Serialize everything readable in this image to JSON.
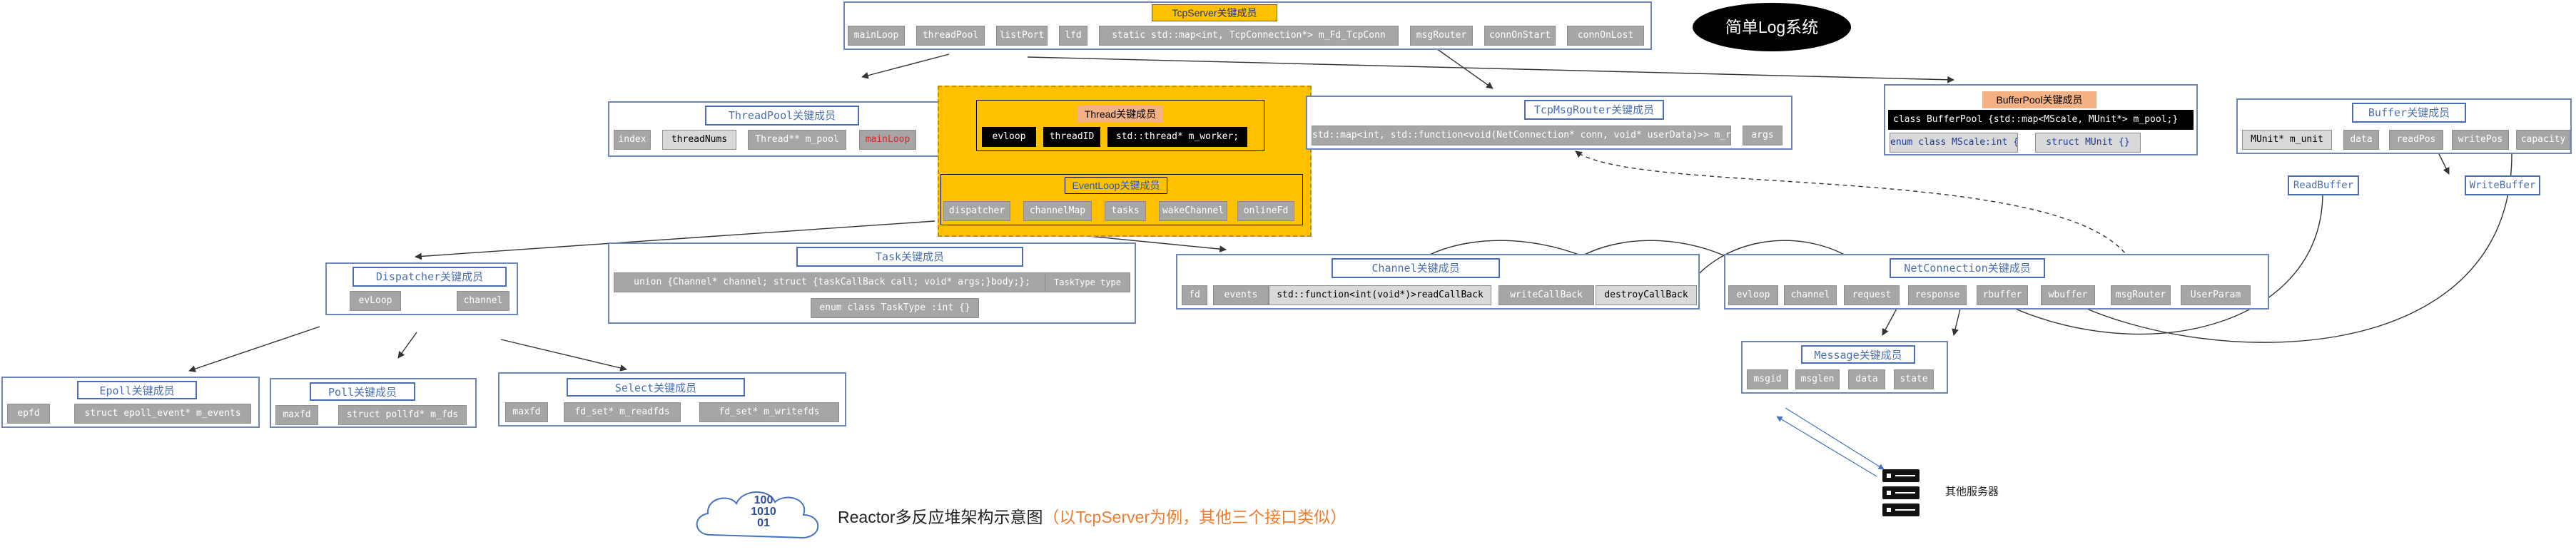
{
  "log_system_title": "简单Log系统",
  "tcpserver": {
    "title": "TcpServer关键成员",
    "members": [
      "mainLoop",
      "threadPool",
      "listPort",
      "lfd",
      "static std::map<int, TcpConnection*> m_Fd_TcpConn",
      "msgRouter",
      "connOnStart",
      "connOnLost"
    ]
  },
  "threadpool": {
    "title": "ThreadPool关键成员",
    "members": [
      "index",
      "threadNums",
      "Thread** m_pool",
      "mainLoop"
    ]
  },
  "thread": {
    "title": "Thread关键成员",
    "members": [
      "evloop",
      "threadID",
      "std::thread* m_worker;"
    ]
  },
  "eventloop": {
    "title": "EventLoop关键成员",
    "members": [
      "dispatcher",
      "channelMap",
      "tasks",
      "wakeChannel",
      "onlineFd"
    ]
  },
  "msgrouter": {
    "title": "TcpMsgRouter关键成员",
    "members": [
      "std::map<int, std::function<void(NetConnection* conn, void* userData)>> m_router",
      "args"
    ]
  },
  "bufferpool": {
    "title": "BufferPool关键成员",
    "line1": "class BufferPool {std::map<MScale, MUnit*> m_pool;}",
    "enum_member": "enum class MScale:int {}",
    "struct_member": "struct MUnit {}"
  },
  "buffer": {
    "title": "Buffer关键成员",
    "members": [
      "MUnit* m_unit",
      "data",
      "readPos",
      "writePos",
      "capacity"
    ],
    "read_buffer": "ReadBuffer",
    "write_buffer": "WriteBuffer"
  },
  "dispatcher": {
    "title": "Dispatcher关键成员",
    "members": [
      "evLoop",
      "channel"
    ]
  },
  "task": {
    "title": "Task关键成员",
    "members": [
      "union {Channel* channel; struct {taskCallBack call; void* args;}body;};",
      "TaskType type",
      "enum class TaskType :int {}"
    ]
  },
  "channel": {
    "title": "Channel关键成员",
    "members": [
      "fd",
      "events",
      "std::function<int(void*)>readCallBack",
      "writeCallBack",
      "destroyCallBack"
    ]
  },
  "netconnection": {
    "title": "NetConnection关键成员",
    "members": [
      "evloop",
      "channel",
      "request",
      "response",
      "rbuffer",
      "wbuffer",
      "msgRouter",
      "UserParam"
    ]
  },
  "message": {
    "title": "Message关键成员",
    "members": [
      "msgid",
      "msglen",
      "data",
      "state"
    ]
  },
  "epoll": {
    "title": "Epoll关键成员",
    "members": [
      "epfd",
      "struct epoll_event* m_events"
    ]
  },
  "poll": {
    "title": "Poll关键成员",
    "members": [
      "maxfd",
      "struct pollfd* m_fds"
    ]
  },
  "select": {
    "title": "Select关键成员",
    "members": [
      "maxfd",
      "fd_set* m_readfds",
      "fd_set* m_writefds"
    ]
  },
  "cloud_glyph": "100\n1010\n01",
  "caption_main": "Reactor多反应堆架构示意图",
  "caption_note": "（以TcpServer为例，其他三个接口类似）",
  "server_label": "其他服务器",
  "colors": {
    "frame_border": "#6e87b8",
    "title_text": "#4a6fb0",
    "chip_grey": "#a6a6a6",
    "highlight_orange": "#ffc000",
    "title_orange_fill": "#f4b183",
    "caption_orange": "#ed7d31"
  }
}
